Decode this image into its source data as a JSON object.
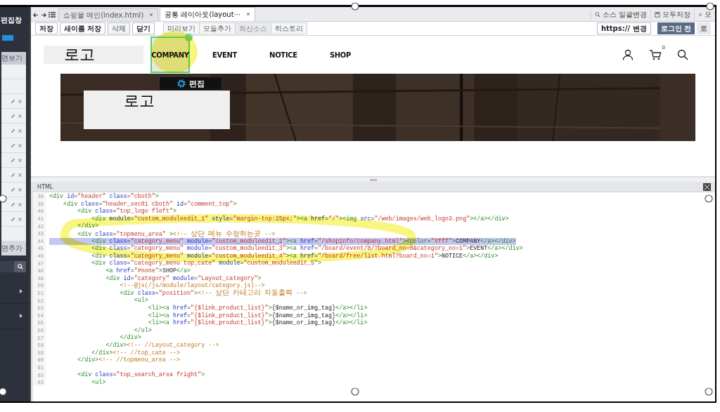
{
  "sidebar": {
    "title": "편집창",
    "view_label": "면보기",
    "add_label": "면추가",
    "items": [
      {
        "kind": "blank"
      },
      {
        "kind": "blank"
      },
      {
        "kind": "module"
      },
      {
        "kind": "module"
      },
      {
        "kind": "module"
      },
      {
        "kind": "module"
      },
      {
        "kind": "module"
      },
      {
        "kind": "module"
      },
      {
        "kind": "module"
      },
      {
        "kind": "module"
      },
      {
        "kind": "module"
      },
      {
        "kind": "blank"
      }
    ]
  },
  "tabs": [
    {
      "label": "쇼핑몰 메인(index.html)",
      "selected": false
    },
    {
      "label": "공통 레이아웃(layout···",
      "selected": true
    }
  ],
  "top_actions": [
    {
      "kind": "search",
      "label": "소스 일괄변경"
    },
    {
      "kind": "save",
      "label": "모두저장"
    },
    {
      "kind": "close",
      "label": "모"
    }
  ],
  "toolbar": {
    "file_buttons": [
      {
        "label": "저장",
        "disabled": false
      },
      {
        "label": "새이름 저장",
        "disabled": false
      },
      {
        "label": "삭제",
        "disabled": true
      },
      {
        "label": "닫기",
        "disabled": false
      }
    ],
    "view_buttons": [
      {
        "label": "미리보기",
        "disabled": false
      },
      {
        "label": "모듈추가",
        "disabled": false
      },
      {
        "label": "최신소스",
        "disabled": true
      },
      {
        "label": "히스토리",
        "disabled": false
      }
    ],
    "https_button": "https:// 변경",
    "login_tabs": [
      {
        "label": "로그인 전",
        "selected": true
      },
      {
        "label": "로",
        "selected": false
      }
    ]
  },
  "preview": {
    "logo": "로고",
    "menu": [
      {
        "label": "COMPANY",
        "selected": true
      },
      {
        "label": "EVENT",
        "selected": false
      },
      {
        "label": "NOTICE",
        "selected": false
      },
      {
        "label": "SHOP",
        "selected": false
      }
    ],
    "cart_count": "0",
    "edit_button": "편집",
    "banner_logo": "로고"
  },
  "code": {
    "title": "HTML",
    "lines": [
      {
        "number": "38",
        "text": "<div id=\"header\" class=\"cboth\">",
        "selected": false
      },
      {
        "number": "39",
        "text": "    <div class=\"header_sec01 cboth\" id=\"comment_top\">",
        "selected": false
      },
      {
        "number": "40",
        "text": "        <div class=\"top_logo fleft\">",
        "selected": false
      },
      {
        "number": "41",
        "text": "            <div module=\"custom_moduleedit_1\" style=\"margin-top:25px;\"><a href=\"/\"><img src=\"/web/images/web_logo3.png\"></a></div>",
        "selected": false
      },
      {
        "number": "42",
        "text": "        </div>",
        "selected": false
      },
      {
        "number": "43",
        "text": "        <div class=\"topmenu_area\" ><!-- 상단 메뉴 수정하는곳 -->",
        "selected": false
      },
      {
        "number": "44",
        "text": "            <div class=\"category_menu\" module=\"custom_moduleedit_2\"><a href=\"/shopinfo/company.html\"><color=\"#fff\">COMPANY</a></div>",
        "selected": true
      },
      {
        "number": "45",
        "text": "            <div class=\"category_menu\" module=\"custom_moduleedit_3\"><a href=\"/board/event/8/?board_no=8&category_no=1\">EVENT</a></div>",
        "selected": false
      },
      {
        "number": "46",
        "text": "            <div class=\"category_menu\" module=\"custom_moduleedit_4\"><a href=\"/board/free/list.html?board_no=1\">NOTICE</a></div>",
        "selected": false
      },
      {
        "number": "47",
        "text": "            <div class=\"category_menu top_cate\" module=\"custom_moduleedit_5\">",
        "selected": false
      },
      {
        "number": "48",
        "text": "                <a href=\"#none\">SHOP</a>",
        "selected": false
      },
      {
        "number": "49",
        "text": "                <div id=\"category\" module=\"Layout_category\">",
        "selected": false
      },
      {
        "number": "50",
        "text": "                    <!--@js(/js/module/layout/category.js)-->",
        "selected": false
      },
      {
        "number": "51",
        "text": "                    <div class=\"position\"><!-- 상단 카테고리 자동출력 -->",
        "selected": false
      },
      {
        "number": "52",
        "text": "                        <ul>",
        "selected": false
      },
      {
        "number": "53",
        "text": "                            <li><a href=\"{$link_product_list}\">{$name_or_img_tag}</a></li>",
        "selected": false
      },
      {
        "number": "54",
        "text": "                            <li><a href=\"{$link_product_list}\">{$name_or_img_tag}</a></li>",
        "selected": false
      },
      {
        "number": "55",
        "text": "                            <li><a href=\"{$link_product_list}\">{$name_or_img_tag}</a></li>",
        "selected": false
      },
      {
        "number": "56",
        "text": "                        </ul>",
        "selected": false
      },
      {
        "number": "57",
        "text": "                    </div>",
        "selected": false
      },
      {
        "number": "58",
        "text": "                </div><!-- //Layout_category -->",
        "selected": false
      },
      {
        "number": "59",
        "text": "            </div><!-- //top_cate -->",
        "selected": false
      },
      {
        "number": "60",
        "text": "        </div><!-- //topmenu_area -->",
        "selected": false
      },
      {
        "number": "61"
      },
      {
        "number": "62",
        "text": "        <div class=\"top_search_area fright\">",
        "selected": false
      },
      {
        "number": "63",
        "text": "            <ul>",
        "selected": false
      }
    ]
  }
}
